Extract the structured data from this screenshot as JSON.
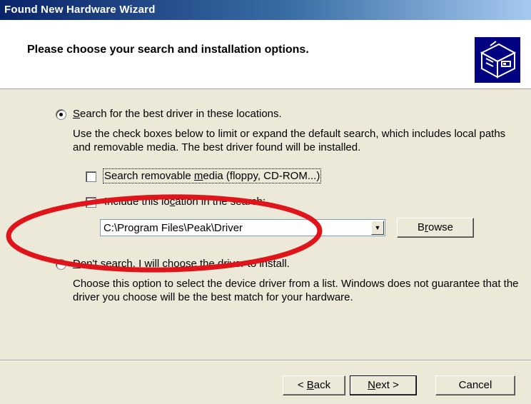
{
  "window": {
    "title": "Found New Hardware Wizard"
  },
  "header": {
    "title": "Please choose your search and installation options."
  },
  "options": {
    "search": {
      "label_key": "S",
      "label_rest": "earch for the best driver in these locations.",
      "description": "Use the check boxes below to limit or expand the default search, which includes local paths and removable media. The best driver found will be installed.",
      "selected": true
    },
    "removable": {
      "label_pre": "Search removable ",
      "label_key": "m",
      "label_rest": "edia (floppy, CD-ROM...)",
      "checked": false
    },
    "include_location": {
      "label_pre": "Include this lo",
      "label_key": "c",
      "label_rest": "ation in the search:",
      "checked": true,
      "check_glyph": "✔",
      "path": "C:\\Program Files\\Peak\\Driver",
      "browse_key": "r",
      "browse_pre": "B",
      "browse_rest": "owse"
    },
    "dont_search": {
      "label_key": "D",
      "label_rest": "on't search. I will choose the driver to install.",
      "description": "Choose this option to select the device driver from a list.  Windows does not guarantee that the driver you choose will be the best match for your hardware.",
      "selected": false
    }
  },
  "buttons": {
    "back_pre": "< ",
    "back_key": "B",
    "back_rest": "ack",
    "next_key": "N",
    "next_rest": "ext >",
    "cancel": "Cancel"
  },
  "icons": {
    "hardware": "hardware-device-icon",
    "dropdown": "chevron-down-icon"
  },
  "colors": {
    "annotation": "#e0141b",
    "title_start": "#0a246a",
    "title_end": "#a6caf0"
  }
}
